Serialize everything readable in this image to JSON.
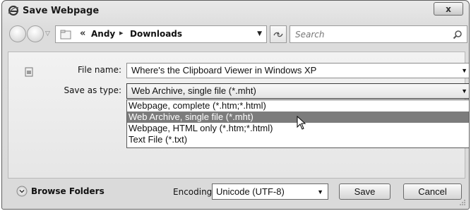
{
  "window": {
    "title": "Save Webpage",
    "close_symbol": "x",
    "icon": "browser-icon"
  },
  "nav": {
    "breadcrumb_prefix": "«",
    "breadcrumb": [
      "Andy",
      "Downloads"
    ],
    "breadcrumb_separator": "▸",
    "search_placeholder": "Search",
    "refresh_symbol": "↻"
  },
  "form": {
    "file_name_label": "File name:",
    "file_name_value": "Where's the Clipboard Viewer in Windows XP",
    "save_type_label": "Save as type:",
    "save_type_value": "Web Archive, single file (*.mht)",
    "save_type_options": [
      "Webpage, complete (*.htm;*.html)",
      "Web Archive, single file (*.mht)",
      "Webpage, HTML only (*.htm;*.html)",
      "Text File (*.txt)"
    ],
    "selected_option_index": 1
  },
  "footer": {
    "browse_label": "Browse Folders",
    "encoding_label": "Encoding",
    "encoding_value": "Unicode (UTF-8)",
    "save_label": "Save",
    "cancel_label": "Cancel"
  },
  "colors": {
    "selected_bg": "#7c7c7c",
    "dialog_bg": "#dcdcdc"
  }
}
